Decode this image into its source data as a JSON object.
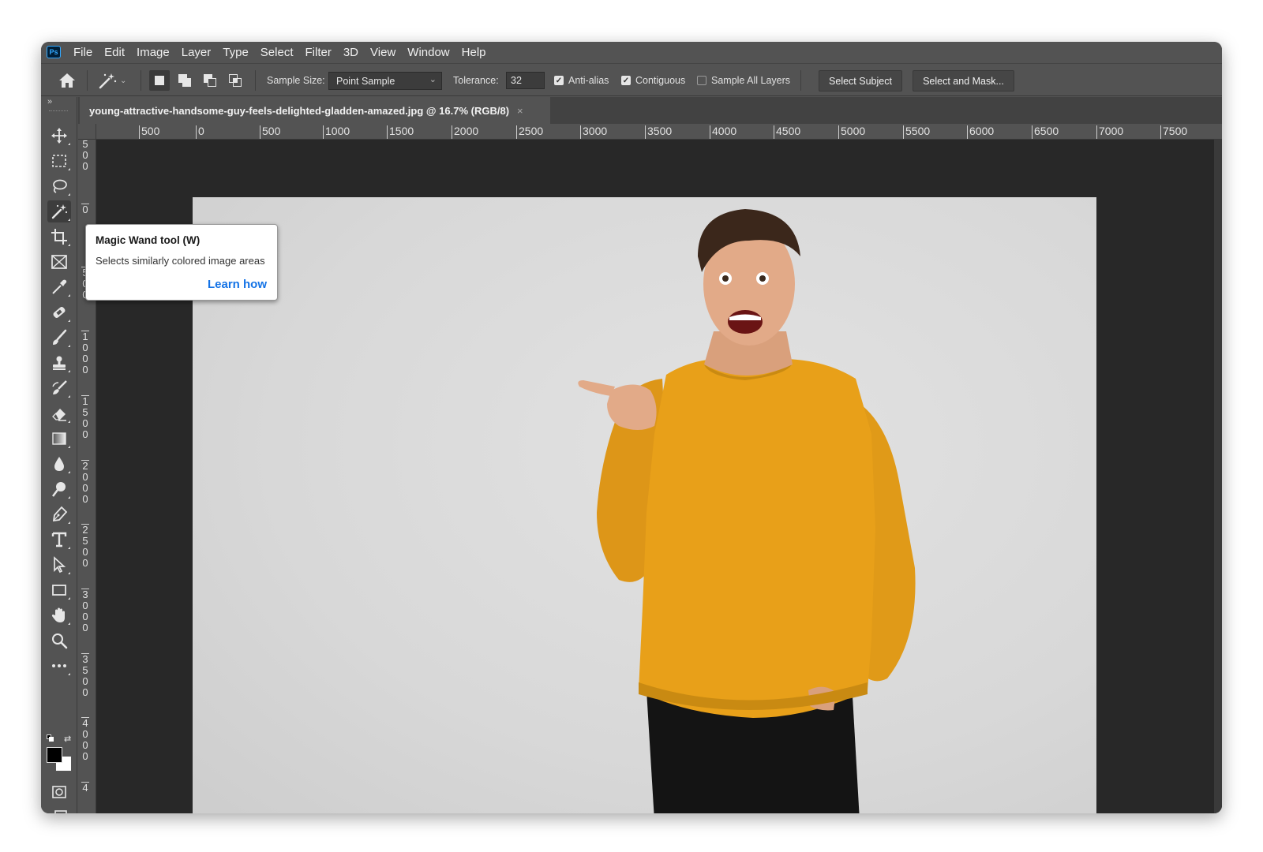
{
  "app": {
    "logo_text": "Ps"
  },
  "menu": [
    "File",
    "Edit",
    "Image",
    "Layer",
    "Type",
    "Select",
    "Filter",
    "3D",
    "View",
    "Window",
    "Help"
  ],
  "options": {
    "sample_size_label": "Sample Size:",
    "sample_size_value": "Point Sample",
    "tolerance_label": "Tolerance:",
    "tolerance_value": "32",
    "anti_alias_label": "Anti-alias",
    "anti_alias_checked": true,
    "contiguous_label": "Contiguous",
    "contiguous_checked": true,
    "sample_all_layers_label": "Sample All Layers",
    "sample_all_layers_checked": false,
    "select_subject_label": "Select Subject",
    "select_mask_label": "Select and Mask..."
  },
  "document": {
    "tab_title": "young-attractive-handsome-guy-feels-delighted-gladden-amazed.jpg @ 16.7% (RGB/8)",
    "close_glyph": "×"
  },
  "ruler_top": [
    "500",
    "0",
    "500",
    "1000",
    "1500",
    "2000",
    "2500",
    "3000",
    "3500",
    "4000",
    "4500",
    "5000",
    "5500",
    "6000",
    "6500",
    "7000",
    "7500"
  ],
  "ruler_left": [
    [
      "5",
      "0",
      "0"
    ],
    [
      "0"
    ],
    [
      "5",
      "0",
      "0"
    ],
    [
      "1",
      "0",
      "0",
      "0"
    ],
    [
      "1",
      "5",
      "0",
      "0"
    ],
    [
      "2",
      "0",
      "0",
      "0"
    ],
    [
      "2",
      "5",
      "0",
      "0"
    ],
    [
      "3",
      "0",
      "0",
      "0"
    ],
    [
      "3",
      "5",
      "0",
      "0"
    ],
    [
      "4",
      "0",
      "0",
      "0"
    ],
    [
      "4"
    ]
  ],
  "tooltip": {
    "title": "Magic Wand tool (W)",
    "description": "Selects similarly colored image areas",
    "link": "Learn how"
  },
  "colors": {
    "sweater": "#e8a019",
    "background_gray": "#d9d9d9",
    "link_blue": "#1473e6",
    "foreground_color": "#000000",
    "background_color": "#ffffff"
  }
}
